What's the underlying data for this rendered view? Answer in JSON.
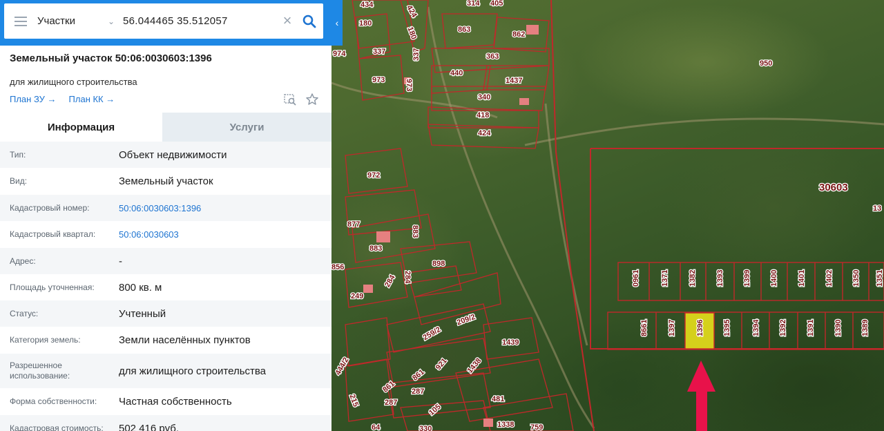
{
  "search": {
    "layer": "Участки",
    "query": "56.044465 35.512057"
  },
  "object": {
    "title": "Земельный участок 50:06:0030603:1396",
    "subtitle": "для жилищного строительства",
    "link_plan_zu": "План ЗУ →",
    "link_plan_kk": "План КК →"
  },
  "tabs": {
    "info": "Информация",
    "services": "Услуги"
  },
  "rows": [
    {
      "label": "Тип:",
      "value": "Объект недвижимости"
    },
    {
      "label": "Вид:",
      "value": "Земельный участок"
    },
    {
      "label": "Кадастровый номер:",
      "value": "50:06:0030603:1396"
    },
    {
      "label": "Кадастровый квартал:",
      "value": "50:06:0030603"
    },
    {
      "label": "Адрес:",
      "value": "-"
    },
    {
      "label": "Площадь уточненная:",
      "value": "800 кв. м"
    },
    {
      "label": "Статус:",
      "value": "Учтенный"
    },
    {
      "label": "Категория земель:",
      "value": "Земли населённых пунктов"
    },
    {
      "label": "Разрешенное использование:",
      "value": "для жилищного строительства"
    },
    {
      "label": "Форма собственности:",
      "value": "Частная собственность"
    },
    {
      "label": "Кадастровая стоимость:",
      "value": "502 416 руб."
    }
  ],
  "icons": {
    "menu": "burger-menu-icon",
    "dropdown": "chevron-down-icon",
    "clear": "close-icon",
    "search": "search-icon",
    "collapse": "chevron-left-icon",
    "zoom_to": "zoom-to-object-icon",
    "favorite": "star-icon"
  },
  "colors": {
    "accent": "#1e88e5",
    "link": "#1e74d1",
    "parcel_border": "#c0282a",
    "selected_parcel": "#f2e81a",
    "marker_arrow": "#e8124a"
  },
  "map": {
    "quarter_label": "30603",
    "labels_top_row": [
      "0961",
      "1371",
      "1382",
      "1393",
      "1399",
      "1400",
      "1401",
      "1402",
      "1350",
      "1351"
    ],
    "labels_bottom_row": [
      "8661",
      "1397",
      "1396",
      "1395",
      "1394",
      "1392",
      "1391",
      "1390",
      "1389"
    ],
    "selected_label": "1396",
    "labels_other": [
      "434",
      "424",
      "314",
      "405",
      "180",
      "180",
      "863",
      "862",
      "974",
      "337",
      "337",
      "363",
      "950",
      "973",
      "973",
      "440",
      "1437",
      "340",
      "418",
      "424",
      "972",
      "877",
      "883",
      "883",
      "898",
      "856",
      "249",
      "284",
      "284",
      "259/2",
      "209/2",
      "1439",
      "444/2",
      "921",
      "1438",
      "861",
      "861",
      "215",
      "287",
      "287",
      "105",
      "481",
      "64",
      "330",
      "1338",
      "759"
    ]
  }
}
